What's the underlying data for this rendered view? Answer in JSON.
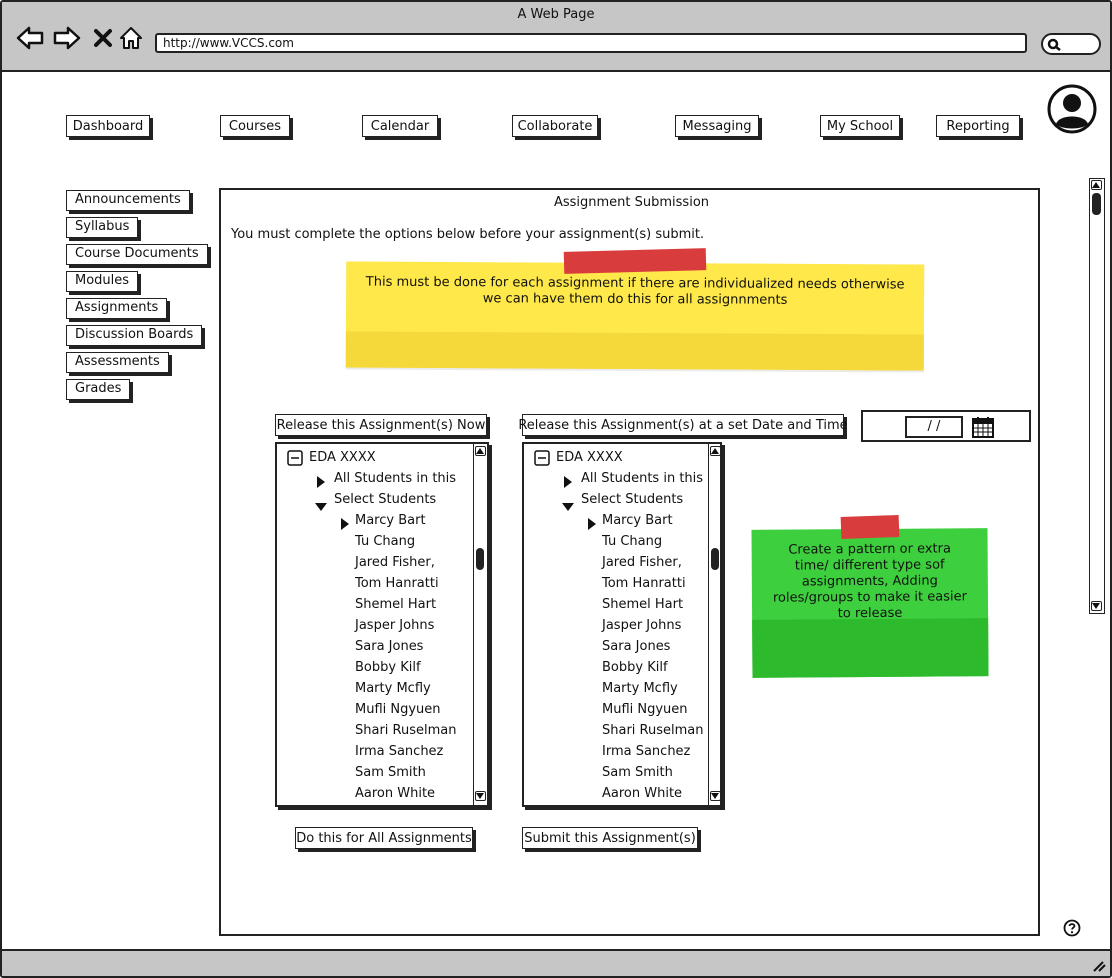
{
  "browser": {
    "window_title": "A Web Page",
    "url": "http://www.VCCS.com",
    "icons": [
      "back-arrow-icon",
      "forward-arrow-icon",
      "close-icon",
      "home-icon",
      "search-icon"
    ]
  },
  "topnav": {
    "items": [
      {
        "label": "Dashboard"
      },
      {
        "label": "Courses"
      },
      {
        "label": "Calendar"
      },
      {
        "label": "Collaborate"
      },
      {
        "label": "Messaging"
      },
      {
        "label": "My School"
      },
      {
        "label": "Reporting"
      }
    ]
  },
  "sidebar": {
    "items": [
      {
        "label": "Announcements"
      },
      {
        "label": "Syllabus"
      },
      {
        "label": "Course Documents"
      },
      {
        "label": "Modules"
      },
      {
        "label": "Assignments"
      },
      {
        "label": "Discussion Boards"
      },
      {
        "label": "Assessments"
      },
      {
        "label": "Grades"
      }
    ]
  },
  "main": {
    "title": "Assignment Submission",
    "intro": "You must complete the options below before your assignment(s) submit.",
    "note_yellow": "This must be done for each assignment if there are individualized needs otherwise we can have them do this for all assignnments",
    "note_green": "Create a pattern or extra time/ different type sof assignments, Adding roles/groups to make it easier to release",
    "release_now_label": "Release this Assignment(s) Now",
    "release_later_label": "Release this Assignment(s) at a set Date and Time",
    "date_value": "/ /",
    "do_all_label": "Do this for All Assignments",
    "submit_label": "Submit this Assignment(s)",
    "tree": {
      "root": "EDA XXXX",
      "all_students": "All Students in this",
      "select_students": "Select Students",
      "students": [
        "Marcy Bart",
        "Tu Chang",
        "Jared Fisher,",
        "Tom Hanratti",
        "Shemel Hart",
        "Jasper Johns",
        "Sara Jones",
        "Bobby Kilf",
        "Marty Mcfly",
        "Mufli Ngyuen",
        "Shari Ruselman",
        "Irma Sanchez",
        "Sam Smith",
        "Aaron White"
      ]
    }
  },
  "colors": {
    "chrome": "#c6c6c6",
    "note_yellow": "#ffe84a",
    "note_green": "#3ecf3e",
    "tape": "#d93c3c"
  }
}
